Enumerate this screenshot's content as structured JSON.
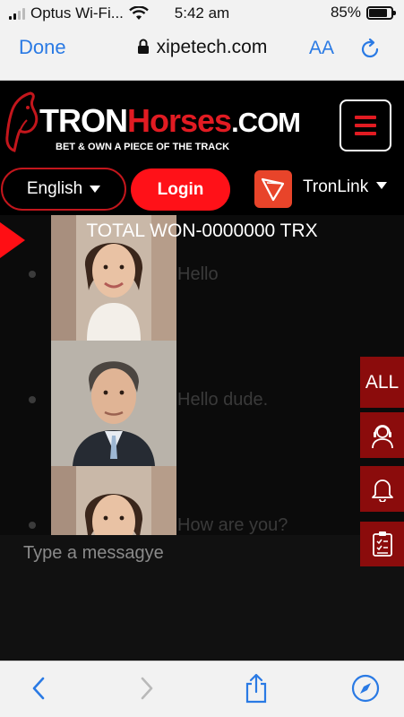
{
  "status_bar": {
    "carrier": "Optus Wi-Fi...",
    "time": "5:42 am",
    "battery_percent": "85%",
    "battery_level": 0.85
  },
  "browser": {
    "done_label": "Done",
    "url": "xipetech.com",
    "text_size_label": "AA"
  },
  "site": {
    "logo_part1": "TRON",
    "logo_part2": "Horses",
    "logo_part3": ".COM",
    "tagline": "BET & OWN A PIECE OF THE TRACK",
    "language": "English",
    "login_label": "Login",
    "wallet_label": "TronLink"
  },
  "chat": {
    "total_won": "TOTAL WON-0000000 TRX",
    "messages": [
      {
        "text": "Hello",
        "avatar": "woman-avatar"
      },
      {
        "text": "Hello dude.",
        "avatar": "man-avatar"
      },
      {
        "text": "How are you?",
        "avatar": "woman-avatar"
      }
    ],
    "input_placeholder": "Type a messagye"
  },
  "side_menu": {
    "all_label": "ALL",
    "icons": [
      "support-agent-icon",
      "bell-icon",
      "clipboard-checklist-icon"
    ]
  },
  "colors": {
    "accent_red": "#ff1118",
    "side_button_bg": "#8b0c0c",
    "ios_blue": "#2a7ae4"
  }
}
